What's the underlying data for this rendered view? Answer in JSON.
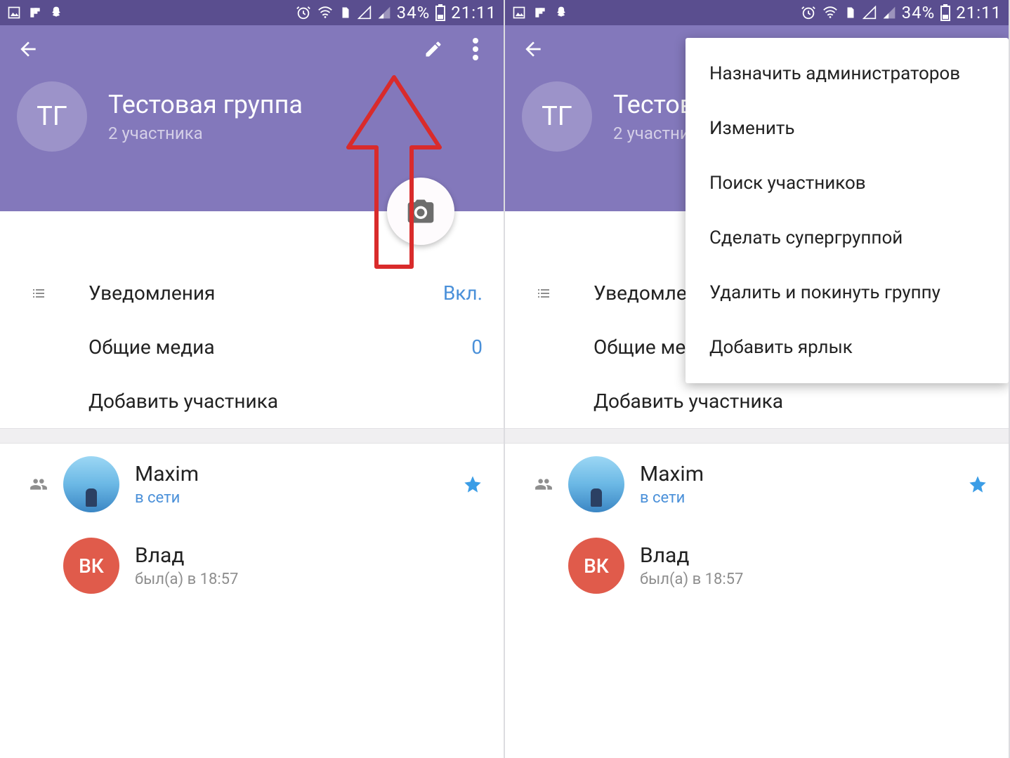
{
  "status": {
    "battery_pct": "34%",
    "time": "21:11"
  },
  "group": {
    "avatar_initials": "ТГ",
    "title": "Тестовая группа",
    "subtitle": "2 участника"
  },
  "settings": {
    "notifications": {
      "label": "Уведомления",
      "value": "Вкл."
    },
    "shared_media": {
      "label": "Общие медиа",
      "value": "0"
    },
    "add_member": {
      "label": "Добавить участника"
    }
  },
  "members": [
    {
      "name": "Maxim",
      "status": "в сети",
      "avatar_type": "photo",
      "avatar_text": "",
      "starred": true,
      "online": true
    },
    {
      "name": "Влад",
      "status": "был(а) в 18:57",
      "avatar_type": "initials",
      "avatar_text": "ВК",
      "starred": false,
      "online": false
    }
  ],
  "menu": {
    "items": [
      "Назначить администраторов",
      "Изменить",
      "Поиск участников",
      "Сделать супергруппой",
      "Удалить и покинуть группу",
      "Добавить ярлык"
    ]
  }
}
